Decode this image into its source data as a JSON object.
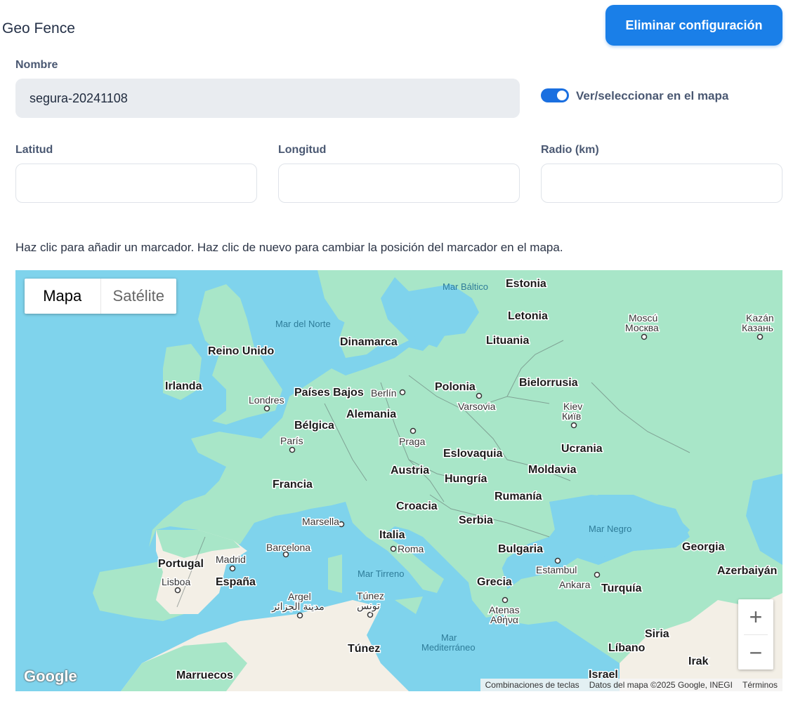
{
  "header": {
    "title": "Geo Fence",
    "delete_button": "Eliminar configuración"
  },
  "form": {
    "name_label": "Nombre",
    "name_value": "segura-20241108",
    "toggle_label": "Ver/seleccionar en el mapa",
    "toggle_on": true,
    "lat_label": "Latitud",
    "lat_value": "",
    "lng_label": "Longitud",
    "lng_value": "",
    "radius_label": "Radio (km)",
    "radius_value": ""
  },
  "hint": "Haz clic para añadir un marcador. Haz clic de nuevo para cambiar la posición del marcador en el mapa.",
  "map": {
    "type_map": "Mapa",
    "type_satellite": "Satélite",
    "zoom_in": "+",
    "zoom_out": "−",
    "logo": "Google",
    "attribution": {
      "shortcuts": "Combinaciones de teclas",
      "data": "Datos del mapa ©2025 Google, INEGI",
      "terms": "Términos"
    },
    "countries": [
      "Estonia",
      "Letonia",
      "Dinamarca",
      "Lituania",
      "Reino Unido",
      "Irlanda",
      "Países Bajos",
      "Polonia",
      "Bielorrusia",
      "Alemania",
      "Bélgica",
      "Eslovaquia",
      "Ucrania",
      "Austria",
      "Moldavia",
      "Francia",
      "Hungría",
      "Rumanía",
      "Croacia",
      "Serbia",
      "Italia",
      "Bulgaria",
      "Georgia",
      "Portugal",
      "España",
      "Azerbaiyán",
      "Grecia",
      "Turquía",
      "Siria",
      "Túnez",
      "Líbano",
      "Irak",
      "Marruecos",
      "Israel"
    ],
    "cities": [
      "Moscú",
      "Москва",
      "Kazán",
      "Казань",
      "Berlín",
      "Londres",
      "Varsovia",
      "Kiev",
      "Київ",
      "Praga",
      "París",
      "Marsella",
      "Barcelona",
      "Roma",
      "Madrid",
      "Lisboa",
      "Estambul",
      "Ankara",
      "Argel",
      "مدينة الجزائر",
      "Túnez",
      "تونس",
      "Atenas",
      "Αθήνα"
    ],
    "seas": [
      "Mar Báltico",
      "Mar del Norte",
      "Mar Negro",
      "Mar Tirreno",
      "Mar",
      "Mediterráneo"
    ]
  },
  "colors": {
    "primary": "#1a7fe8",
    "water": "#7fd3ec",
    "land": "#a8e6c8",
    "arid_land": "#f3efe6"
  }
}
